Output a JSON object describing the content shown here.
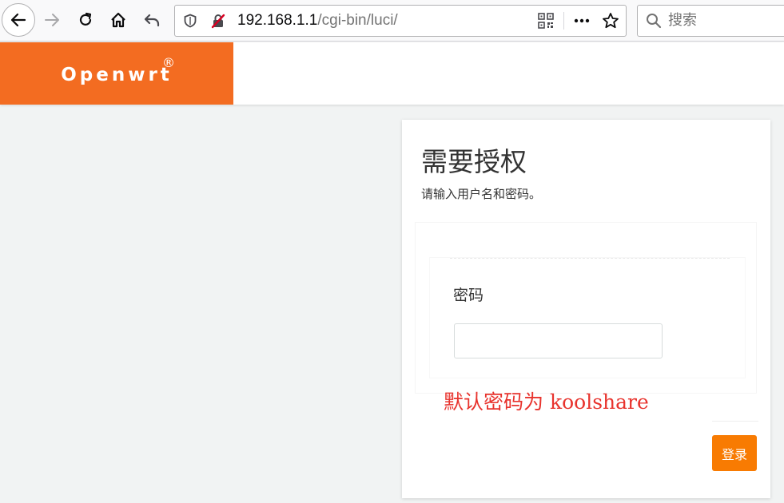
{
  "browser": {
    "url_host": "192.168.1.1",
    "url_path": "/cgi-bin/luci/",
    "search_placeholder": "搜索"
  },
  "header": {
    "brand": "Openwrt",
    "brand_mark": "®",
    "brand_color": "#f36c21"
  },
  "login": {
    "title": "需要授权",
    "description": "请输入用户名和密码。",
    "password_label": "密码",
    "password_value": "",
    "login_button": "登录",
    "button_color": "#f87b02"
  },
  "annotation": {
    "text": "默认密码为 koolshare",
    "color": "#e8332d"
  }
}
